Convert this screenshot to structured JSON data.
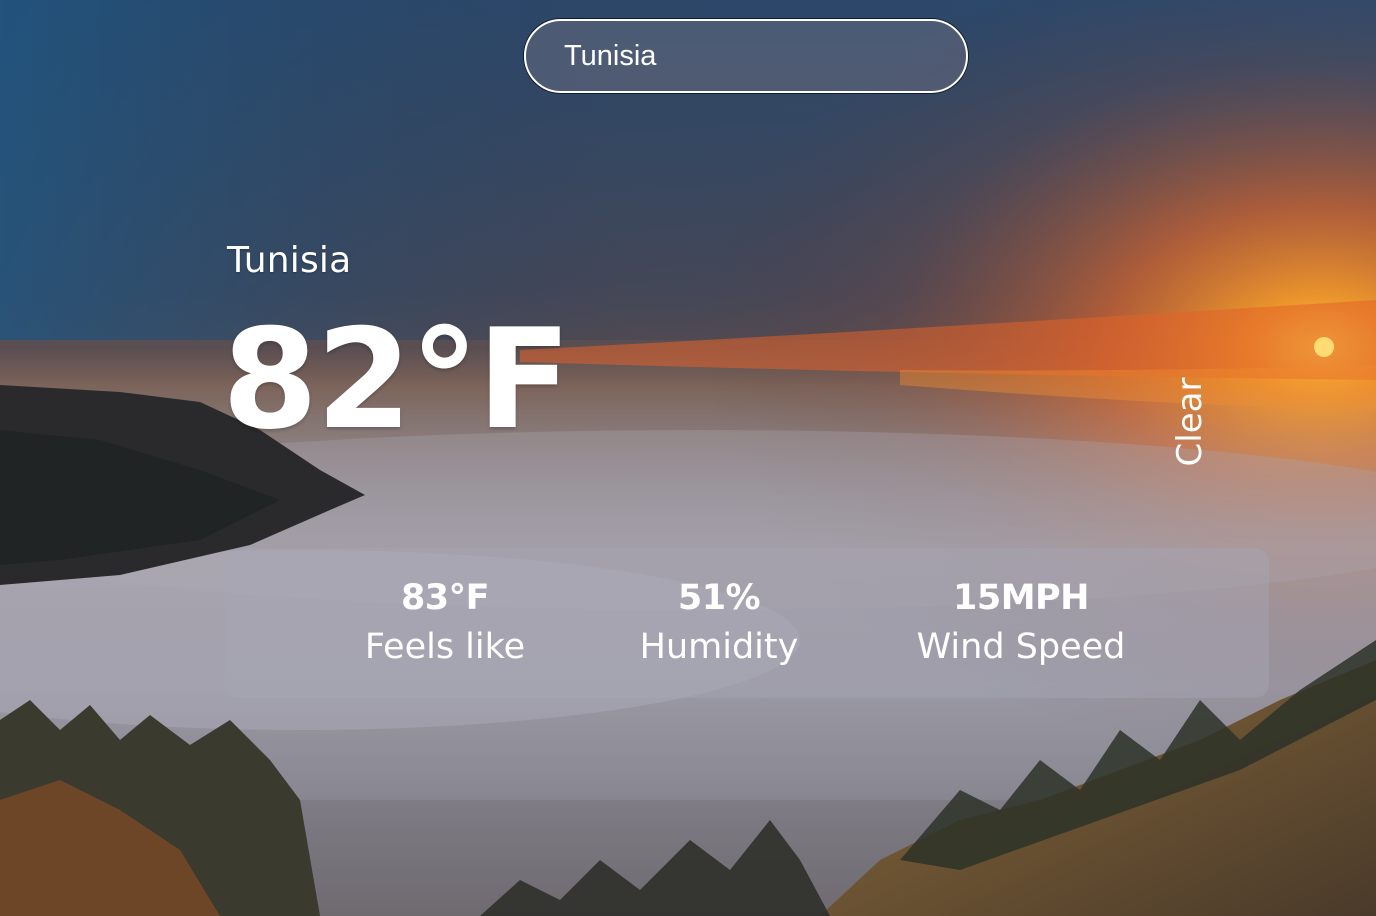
{
  "search": {
    "value": "Tunisia",
    "placeholder": ""
  },
  "location": {
    "name": "Tunisia"
  },
  "weather": {
    "temperature": "82°F",
    "condition": "Clear"
  },
  "stats": [
    {
      "value": "83°F",
      "label": "Feels like"
    },
    {
      "value": "51%",
      "label": "Humidity"
    },
    {
      "value": "15MPH",
      "label": "Wind Speed"
    }
  ],
  "colors": {
    "text": "#ffffff",
    "stats_panel": "rgba(168,168,182,0.42)",
    "search_border": "#ffffff"
  }
}
